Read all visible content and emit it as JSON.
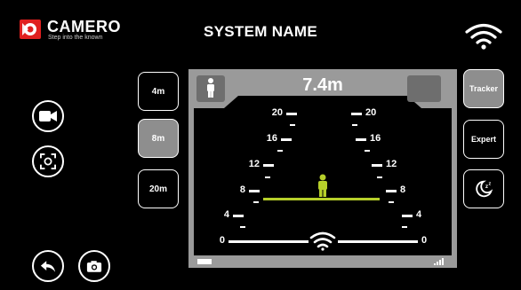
{
  "logo": {
    "brand": "CAMERO",
    "tagline": "Step into the known"
  },
  "header": {
    "title": "SYSTEM NAME"
  },
  "range_buttons": [
    {
      "label": "4m",
      "active": false
    },
    {
      "label": "8m",
      "active": true
    },
    {
      "label": "20m",
      "active": false
    }
  ],
  "mode_buttons": [
    {
      "label": "Tracker",
      "active": true
    },
    {
      "label": "Expert",
      "active": false
    }
  ],
  "display": {
    "distance": "7.4m",
    "scale_left": [
      "20",
      "16",
      "12",
      "8",
      "4",
      "0"
    ],
    "scale_right": [
      "20",
      "16",
      "12",
      "8",
      "4",
      "0"
    ],
    "target_color": "#b6cf2a"
  },
  "icons": {
    "video": "video-camera-icon",
    "focus": "focus-frame-icon",
    "back": "back-arrow-icon",
    "snapshot": "camera-icon",
    "sleep": "sleep-moon-icon",
    "wifi": "wifi-icon"
  },
  "colors": {
    "accent": "#b6cf2a",
    "brand_red": "#e0201f",
    "active_button": "#8e8e8e",
    "screen_frame": "#9a9a9a"
  }
}
